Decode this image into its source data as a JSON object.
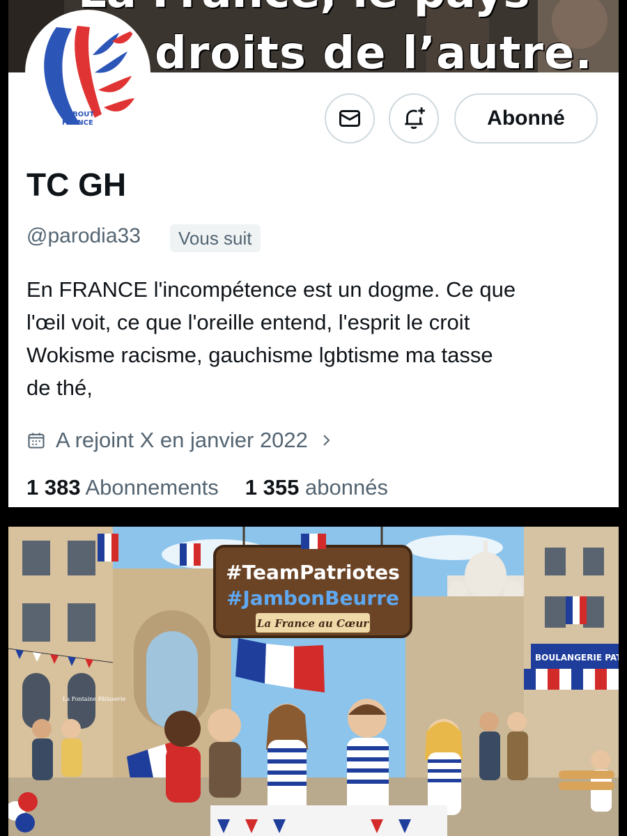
{
  "banner": {
    "text_top": "La France, le pays",
    "text": "droits de l’autre."
  },
  "avatar": {
    "logo_text_1": "DEBOUT",
    "logo_text_2": "FRANCE"
  },
  "actions": {
    "message_icon": "mail-icon",
    "notify_icon": "bell-plus-icon",
    "follow_label": "Abonné"
  },
  "profile": {
    "display_name": "TC GH",
    "handle": "@parodia33",
    "follows_you": "Vous suit",
    "bio_lines": [
      "En FRANCE l'incompétence est un dogme. Ce que",
      "l'œil voit, ce que l'oreille entend, l'esprit le croit",
      "Wokisme  racisme, gauchisme lgbtisme ma tasse",
      "de thé,"
    ],
    "joined": "A rejoint X en janvier 2022",
    "joined_icon": "calendar-icon",
    "following_count": "1 383",
    "following_label": "Abonnements",
    "followers_count": "1 355",
    "followers_label": "abonnés"
  },
  "illustration": {
    "sign_line1": "#TeamPatriotes",
    "sign_line2": "#JambonBeurre",
    "sign_line3": "La France au Cœur",
    "shop_sign": "BOULANGERIE PATISSERIE",
    "shop_small": "La Fontaine Pâtisserie"
  },
  "colors": {
    "text_primary": "#0f1419",
    "text_secondary": "#536471",
    "border": "#cfd9de",
    "french_blue": "#1f3e9c",
    "french_red": "#d32a2a"
  }
}
